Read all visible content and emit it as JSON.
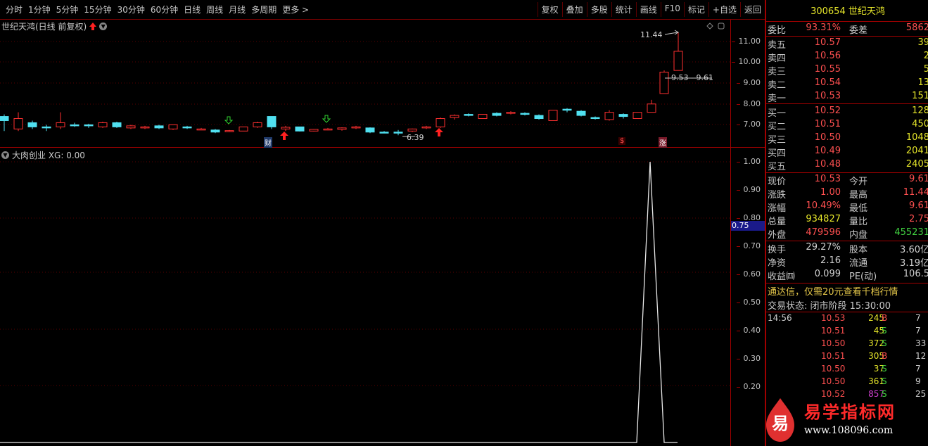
{
  "toolbar": {
    "periods": [
      "分时",
      "1分钟",
      "5分钟",
      "15分钟",
      "30分钟",
      "60分钟",
      "日线",
      "周线",
      "月线",
      "多周期",
      "更多 >"
    ],
    "actions": [
      "复权",
      "叠加",
      "多股",
      "统计",
      "画线",
      "F10",
      "标记",
      "+自选",
      "返回"
    ]
  },
  "kline": {
    "title": "世纪天鸿(日线 前复权)",
    "axis": [
      "11.00",
      "10.00",
      "9.00",
      "8.00",
      "7.00"
    ],
    "high_label": "11.44",
    "range_label": "9.53 - 9.61",
    "low_label": "6.39",
    "cai_badge": "财",
    "s_badge": "$",
    "zhang_badge": "涨"
  },
  "indicator": {
    "title": "大肉创业  XG: 0.00",
    "axis": [
      "1.00",
      "0.90",
      "0.80",
      "0.70",
      "0.60",
      "0.50",
      "0.40",
      "0.30",
      "0.20"
    ],
    "cursor_value": "0.75"
  },
  "quote": {
    "code": "300654",
    "name": "世纪天鸿",
    "weibi": {
      "label": "委比",
      "value": "93.31%",
      "label2": "委差",
      "value2": "5862"
    },
    "asks": [
      {
        "label": "卖五",
        "price": "10.57",
        "vol": "39"
      },
      {
        "label": "卖四",
        "price": "10.56",
        "vol": "2"
      },
      {
        "label": "卖三",
        "price": "10.55",
        "vol": "5"
      },
      {
        "label": "卖二",
        "price": "10.54",
        "vol": "13"
      },
      {
        "label": "卖一",
        "price": "10.53",
        "vol": "151"
      }
    ],
    "bids": [
      {
        "label": "买一",
        "price": "10.52",
        "vol": "128"
      },
      {
        "label": "买二",
        "price": "10.51",
        "vol": "450"
      },
      {
        "label": "买三",
        "price": "10.50",
        "vol": "1048"
      },
      {
        "label": "买四",
        "price": "10.49",
        "vol": "2041"
      },
      {
        "label": "买五",
        "price": "10.48",
        "vol": "2405"
      }
    ],
    "stats": [
      {
        "l1": "现价",
        "v1": "10.53",
        "c1": "red",
        "l2": "今开",
        "v2": "9.61",
        "c2": "red"
      },
      {
        "l1": "涨跌",
        "v1": "1.00",
        "c1": "red",
        "l2": "最高",
        "v2": "11.44",
        "c2": "red"
      },
      {
        "l1": "涨幅",
        "v1": "10.49%",
        "c1": "red",
        "l2": "最低",
        "v2": "9.61",
        "c2": "red"
      },
      {
        "l1": "总量",
        "v1": "934827",
        "c1": "yel",
        "l2": "量比",
        "v2": "2.75",
        "c2": "red"
      },
      {
        "l1": "外盘",
        "v1": "479596",
        "c1": "red",
        "l2": "内盘",
        "v2": "455231",
        "c2": "green"
      }
    ],
    "stats2": [
      {
        "l1": "换手",
        "v1": "29.27%",
        "l2": "股本",
        "v2": "3.60亿"
      },
      {
        "l1": "净资",
        "v1": "2.16",
        "l2": "流通",
        "v2": "3.19亿"
      },
      {
        "l1": "收益㈣",
        "v1": "0.099",
        "l2": "PE(动)",
        "v2": "106.5"
      }
    ],
    "promo": "通达信，仅需20元查看千档行情",
    "status": "交易状态: 闭市阶段 15:30:00",
    "ticks": [
      {
        "t": "14:56",
        "p": "10.53",
        "v": "245",
        "d": "B",
        "n": "7",
        "vc": "yel",
        "dc": "red"
      },
      {
        "t": "",
        "p": "10.51",
        "v": "45",
        "d": "S",
        "n": "7",
        "vc": "yel",
        "dc": "green"
      },
      {
        "t": "",
        "p": "10.50",
        "v": "372",
        "d": "S",
        "n": "33",
        "vc": "yel",
        "dc": "green"
      },
      {
        "t": "",
        "p": "10.51",
        "v": "305",
        "d": "B",
        "n": "12",
        "vc": "yel",
        "dc": "red"
      },
      {
        "t": "",
        "p": "10.50",
        "v": "37",
        "d": "S",
        "n": "7",
        "vc": "yel",
        "dc": "green"
      },
      {
        "t": "",
        "p": "10.50",
        "v": "361",
        "d": "S",
        "n": "9",
        "vc": "yel",
        "dc": "green"
      },
      {
        "t": "",
        "p": "10.52",
        "v": "857",
        "d": "S",
        "n": "25",
        "vc": "pur",
        "dc": "green"
      }
    ]
  },
  "logo": {
    "char": "易",
    "title": "易学指标网",
    "url": "www.108096.com"
  }
}
